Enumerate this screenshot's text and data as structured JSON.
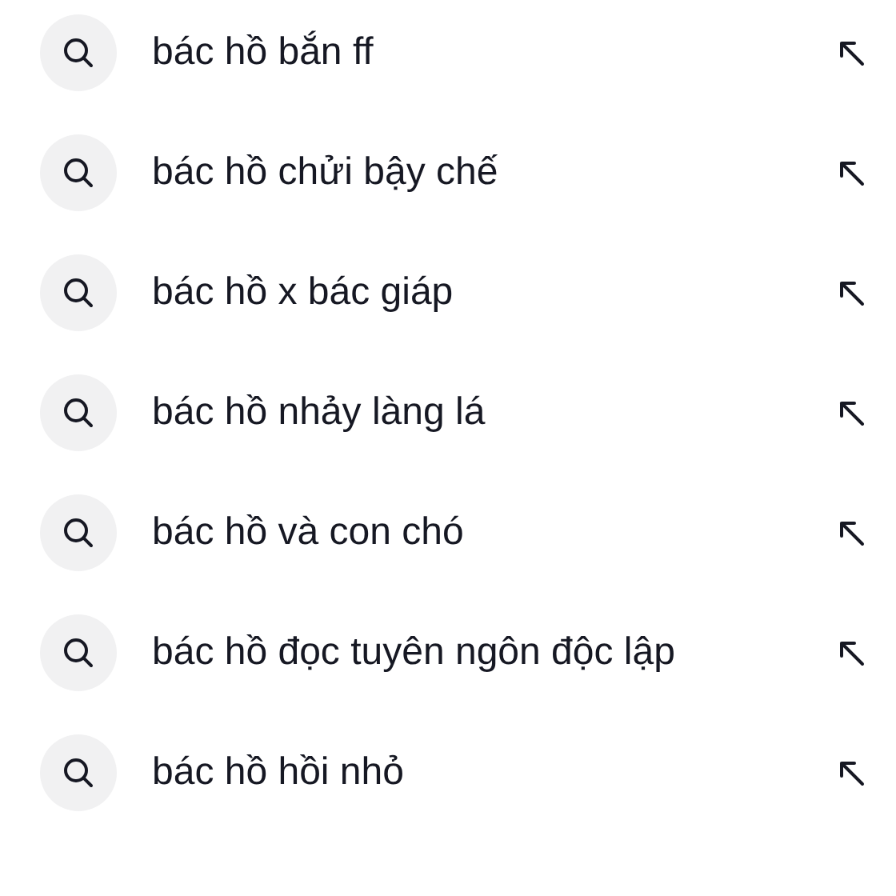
{
  "suggestions": [
    {
      "text": "bác hồ bắn ff"
    },
    {
      "text": "bác hồ chửi bậy chế"
    },
    {
      "text": "bác hồ x bác giáp"
    },
    {
      "text": "bác hồ nhảy làng lá"
    },
    {
      "text": "bác hồ và con chó"
    },
    {
      "text": "bác hồ đọc tuyên ngôn độc lập"
    },
    {
      "text": "bác hồ hồi nhỏ"
    }
  ]
}
